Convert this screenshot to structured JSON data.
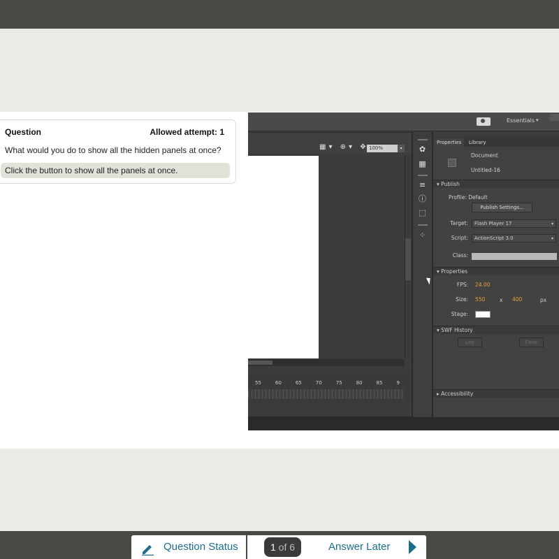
{
  "question_card": {
    "heading": "Question",
    "attempts": "Allowed attempt: 1",
    "prompt": "What would you do to show all the hidden panels at once?",
    "answer": "Click the button to show all the panels at once."
  },
  "flash_app": {
    "workspace": "Essentials",
    "zoom": "100%",
    "timeline_numbers": [
      "55",
      "60",
      "65",
      "70",
      "75",
      "80",
      "85",
      "9"
    ],
    "panel_tabs": [
      "Properties",
      "Library"
    ],
    "document_label": "Document",
    "document_name": "Untitled-16",
    "sections": {
      "publish": "Publish",
      "properties": "Properties",
      "swf_history": "SWF History",
      "accessibility": "Accessibility"
    },
    "profile": "Profile: Default",
    "publish_settings": "Publish Settings...",
    "target_label": "Target:",
    "target_value": "Flash Player 17",
    "script_label": "Script:",
    "script_value": "ActionScript 3.0",
    "class_label": "Class:",
    "fps_label": "FPS:",
    "fps_value": "24.00",
    "size_label": "Size:",
    "size_w": "550",
    "size_x": "x",
    "size_h": "400",
    "size_unit": "px",
    "stage_label": "Stage:",
    "log_button": "Log",
    "clear_button": "Clear"
  },
  "nav": {
    "question_status": "Question Status",
    "page_current": "1",
    "page_of": "of 6",
    "answer_later": "Answer Later"
  },
  "colors": {
    "accent": "#1c6f8c",
    "bar": "#4a4a44",
    "highlight_orange": "#e6a23c"
  }
}
